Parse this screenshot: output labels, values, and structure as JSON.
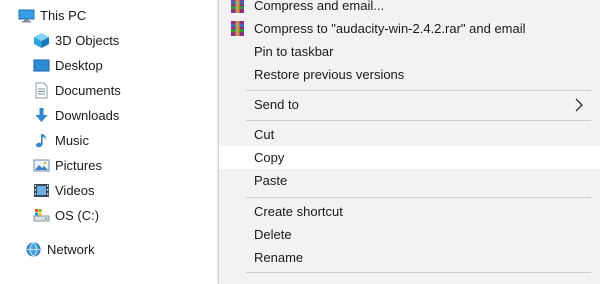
{
  "nav": {
    "this_pc": "This PC",
    "items": [
      {
        "label": "3D Objects",
        "icon": "cube-icon"
      },
      {
        "label": "Desktop",
        "icon": "desktop-icon"
      },
      {
        "label": "Documents",
        "icon": "documents-icon"
      },
      {
        "label": "Downloads",
        "icon": "downloads-icon"
      },
      {
        "label": "Music",
        "icon": "music-icon"
      },
      {
        "label": "Pictures",
        "icon": "pictures-icon"
      },
      {
        "label": "Videos",
        "icon": "videos-icon"
      },
      {
        "label": "OS (C:)",
        "icon": "drive-icon"
      }
    ],
    "network": "Network"
  },
  "menu": {
    "compress_email": "Compress and email...",
    "compress_to_rar_email": "Compress to \"audacity-win-2.4.2.rar\" and email",
    "pin_taskbar": "Pin to taskbar",
    "restore_versions": "Restore previous versions",
    "send_to": "Send to",
    "cut": "Cut",
    "copy": "Copy",
    "paste": "Paste",
    "create_shortcut": "Create shortcut",
    "delete": "Delete",
    "rename": "Rename"
  },
  "colors": {
    "menu_background": "#f2f2f2",
    "highlight": "#ffffff",
    "separator": "#cccccc",
    "folder_blue": "#2e8bd8"
  }
}
